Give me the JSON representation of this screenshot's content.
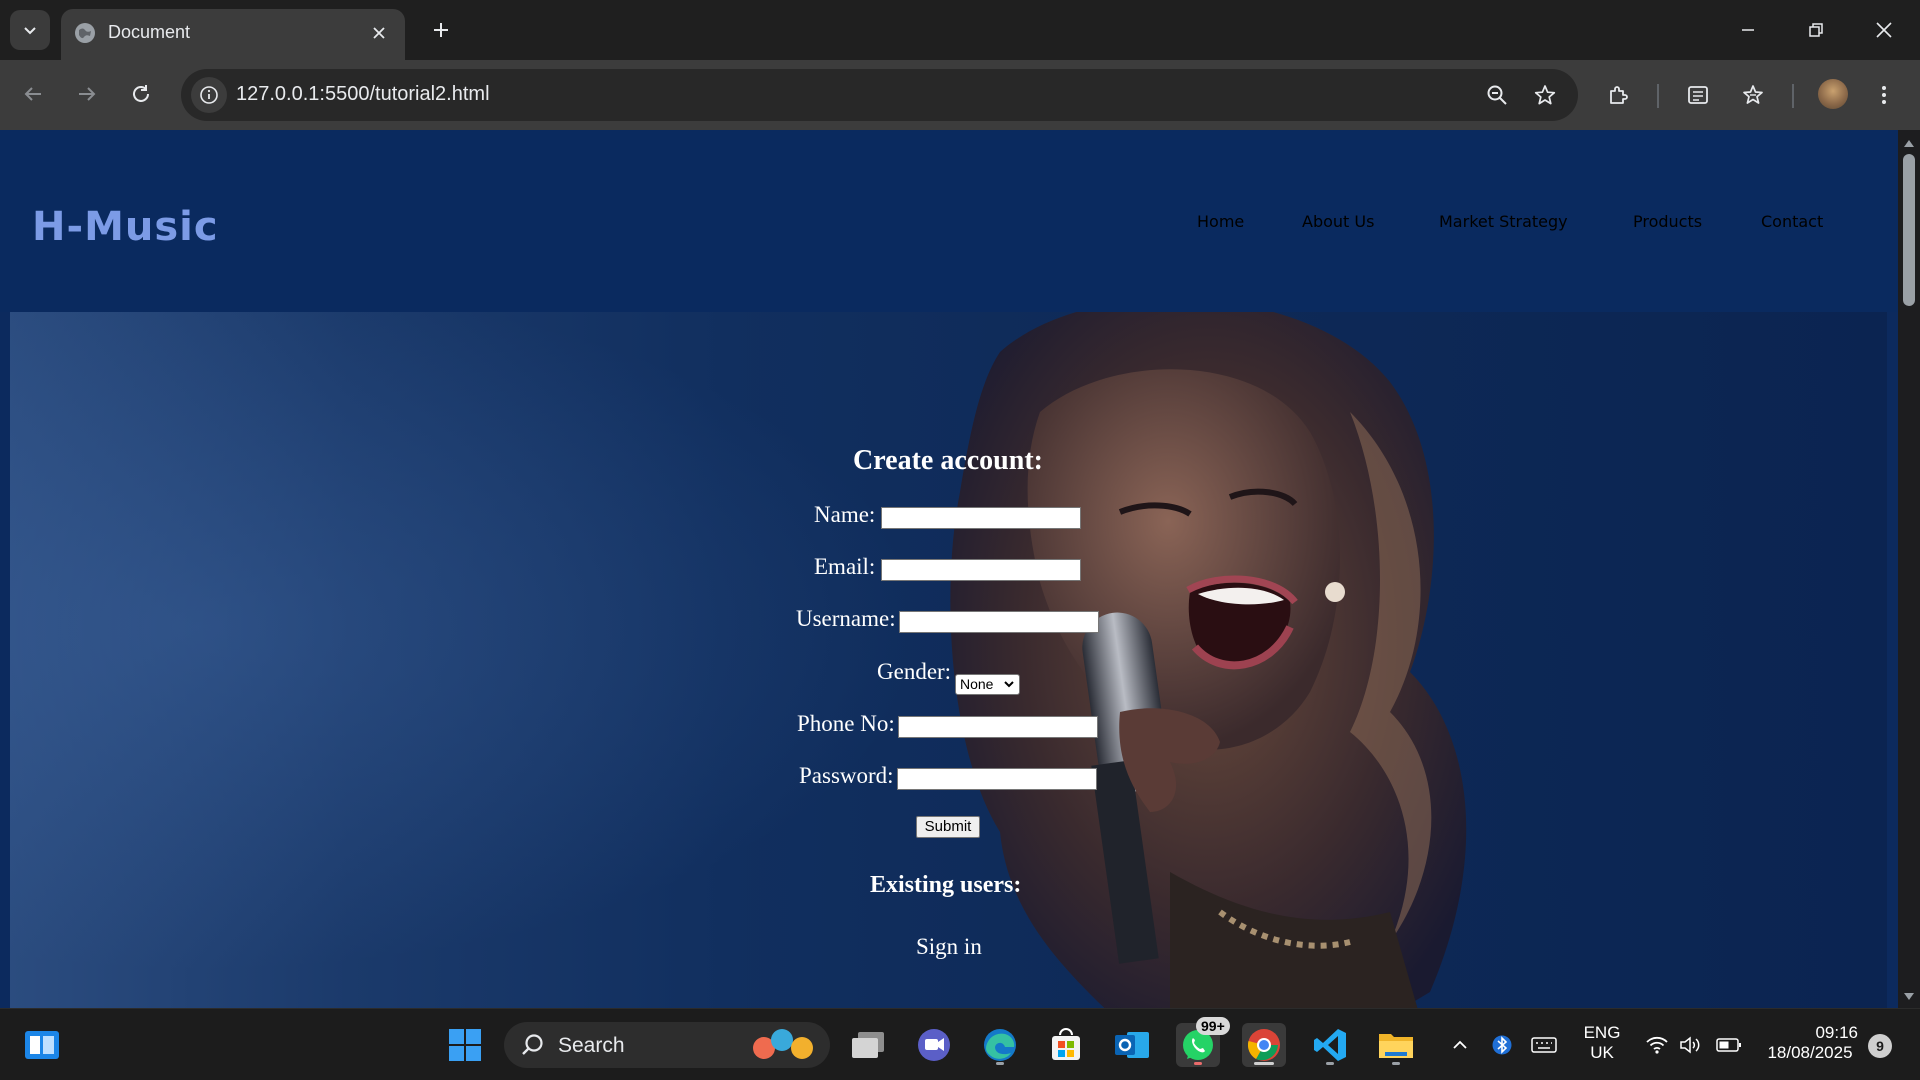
{
  "browser": {
    "tab_title": "Document",
    "url": "127.0.0.1:5500/tutorial2.html"
  },
  "site": {
    "logo": "H-Music",
    "nav": [
      "Home",
      "About Us",
      "Market Strategy",
      "Products",
      "Contact"
    ]
  },
  "form": {
    "title": "Create account:",
    "labels": {
      "name": "Name:",
      "email": "Email:",
      "username": "Username:",
      "gender": "Gender:",
      "phone": "Phone No:",
      "password": "Password:"
    },
    "gender_selected": "None",
    "submit_label": "Submit",
    "existing_title": "Existing users:",
    "signin_label": "Sign in"
  },
  "taskbar": {
    "search_label": "Search",
    "whatsapp_badge": "99+",
    "language": "ENG",
    "region": "UK",
    "time": "09:16",
    "date": "18/08/2025",
    "notifications": "9"
  },
  "colors": {
    "page_bg": "#0a2a5f",
    "logo": "#7c9be6",
    "nav_text": "#ffffff"
  }
}
